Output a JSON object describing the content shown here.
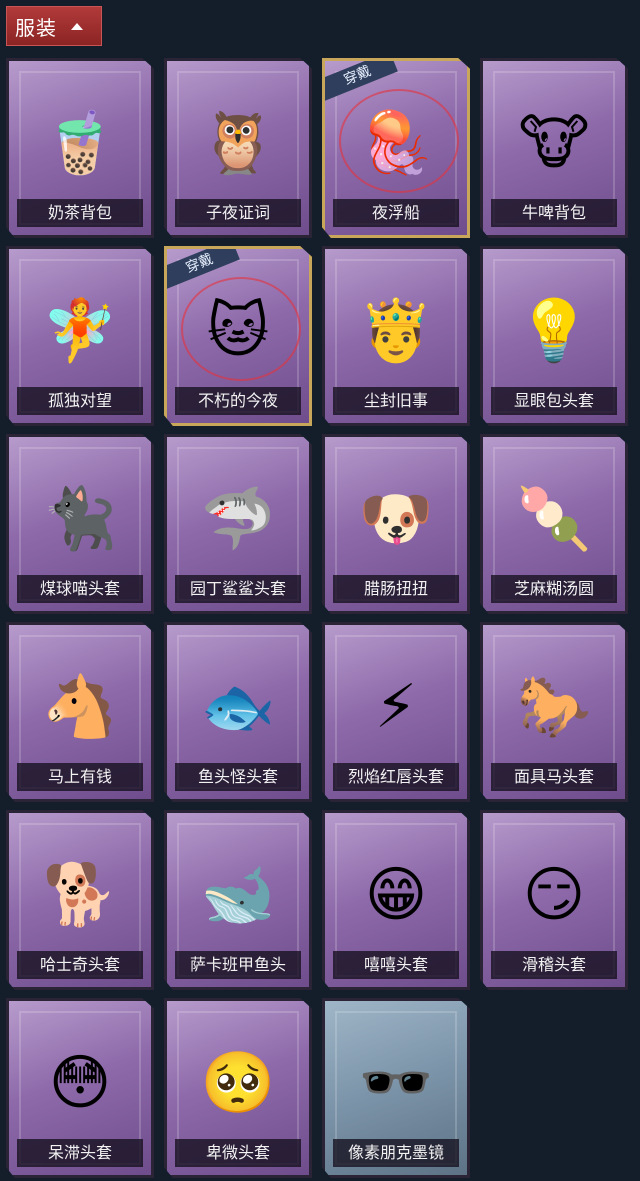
{
  "header": {
    "label": "服装",
    "icon": "chevron-up-icon"
  },
  "equipped_badge": "穿戴",
  "items": [
    {
      "label": "奶茶背包",
      "icon": "🧋",
      "equipped": false,
      "style": "purple"
    },
    {
      "label": "子夜证词",
      "icon": "🦉",
      "equipped": false,
      "style": "purple"
    },
    {
      "label": "夜浮船",
      "icon": "🪼",
      "equipped": true,
      "style": "purple"
    },
    {
      "label": "牛啤背包",
      "icon": "🐮",
      "equipped": false,
      "style": "purple"
    },
    {
      "label": "孤独对望",
      "icon": "🧚",
      "equipped": false,
      "style": "purple"
    },
    {
      "label": "不朽的今夜",
      "icon": "🐱",
      "equipped": true,
      "style": "purple"
    },
    {
      "label": "尘封旧事",
      "icon": "🤴",
      "equipped": false,
      "style": "purple"
    },
    {
      "label": "显眼包头套",
      "icon": "💡",
      "equipped": false,
      "style": "purple"
    },
    {
      "label": "煤球喵头套",
      "icon": "🐈‍⬛",
      "equipped": false,
      "style": "purple"
    },
    {
      "label": "园丁鲨鲨头套",
      "icon": "🦈",
      "equipped": false,
      "style": "purple"
    },
    {
      "label": "腊肠扭扭",
      "icon": "🐶",
      "equipped": false,
      "style": "purple"
    },
    {
      "label": "芝麻糊汤圆",
      "icon": "🍡",
      "equipped": false,
      "style": "purple"
    },
    {
      "label": "马上有钱",
      "icon": "🐴",
      "equipped": false,
      "style": "purple"
    },
    {
      "label": "鱼头怪头套",
      "icon": "🐟",
      "equipped": false,
      "style": "purple"
    },
    {
      "label": "烈焰红唇头套",
      "icon": "⚡",
      "equipped": false,
      "style": "purple"
    },
    {
      "label": "面具马头套",
      "icon": "🐎",
      "equipped": false,
      "style": "purple"
    },
    {
      "label": "哈士奇头套",
      "icon": "🐕",
      "equipped": false,
      "style": "purple"
    },
    {
      "label": "萨卡班甲鱼头",
      "icon": "🐋",
      "equipped": false,
      "style": "purple"
    },
    {
      "label": "嘻嘻头套",
      "icon": "😁",
      "equipped": false,
      "style": "purple"
    },
    {
      "label": "滑稽头套",
      "icon": "😏",
      "equipped": false,
      "style": "purple"
    },
    {
      "label": "呆滞头套",
      "icon": "😳",
      "equipped": false,
      "style": "purple"
    },
    {
      "label": "卑微头套",
      "icon": "🥺",
      "equipped": false,
      "style": "purple"
    },
    {
      "label": "像素朋克墨镜",
      "icon": "🕶️",
      "equipped": false,
      "style": "glass"
    }
  ]
}
